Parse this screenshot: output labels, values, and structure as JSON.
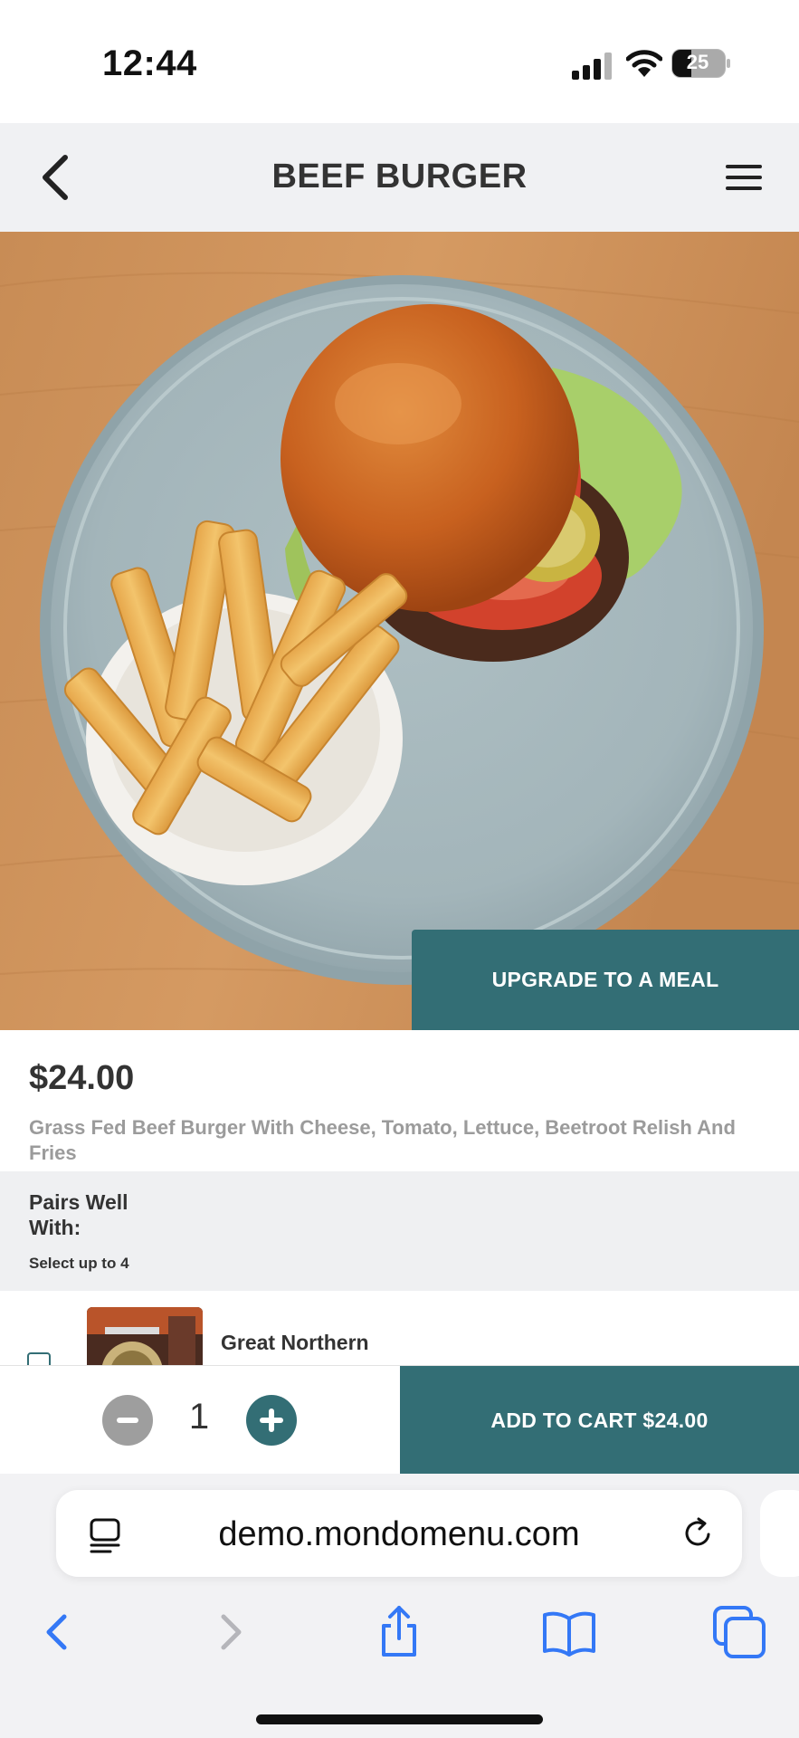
{
  "status_bar": {
    "time": "12:44",
    "battery_level": "25"
  },
  "header": {
    "title": "BEEF BURGER"
  },
  "hero": {
    "upgrade_label": "UPGRADE TO A MEAL"
  },
  "product": {
    "price": "$24.00",
    "description": "Grass Fed Beef Burger With Cheese, Tomato, Lettuce, Beetroot Relish And Fries"
  },
  "pairs": {
    "title": "Pairs Well With:",
    "hint": "Select up to 4",
    "items": [
      {
        "label": "Great Northern"
      }
    ]
  },
  "cart": {
    "quantity": "1",
    "add_label": "ADD TO CART $24.00"
  },
  "browser": {
    "url": "demo.mondomenu.com"
  },
  "colors": {
    "accent": "#336e75",
    "header_bg": "#f0f1f3",
    "muted_text": "#9b9b9b",
    "ios_blue": "#3478f6"
  }
}
